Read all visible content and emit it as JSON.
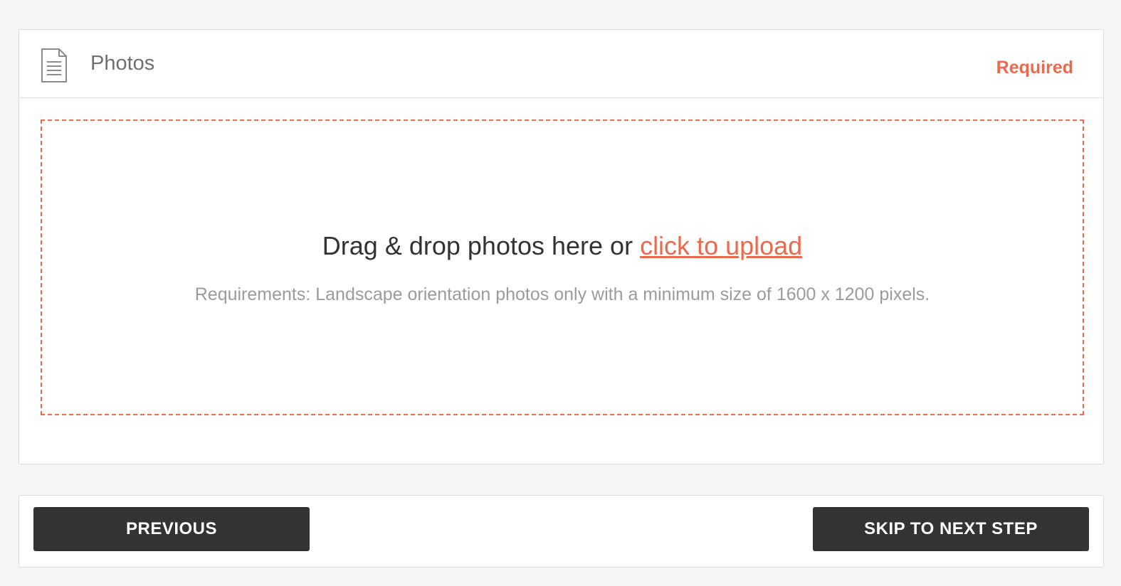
{
  "photos_panel": {
    "title": "Photos",
    "required_label": "Required",
    "icon": "document-icon",
    "dropzone": {
      "prompt_text": "Drag & drop photos here or ",
      "upload_link": "click to upload",
      "requirements": "Requirements: Landscape orientation photos only with a minimum size of 1600 x 1200 pixels."
    }
  },
  "footer": {
    "previous_label": "PREVIOUS",
    "skip_label": "SKIP TO NEXT STEP"
  },
  "colors": {
    "accent": "#ec6a4c",
    "button_bg": "#333333",
    "page_bg": "#f5f5f5"
  }
}
